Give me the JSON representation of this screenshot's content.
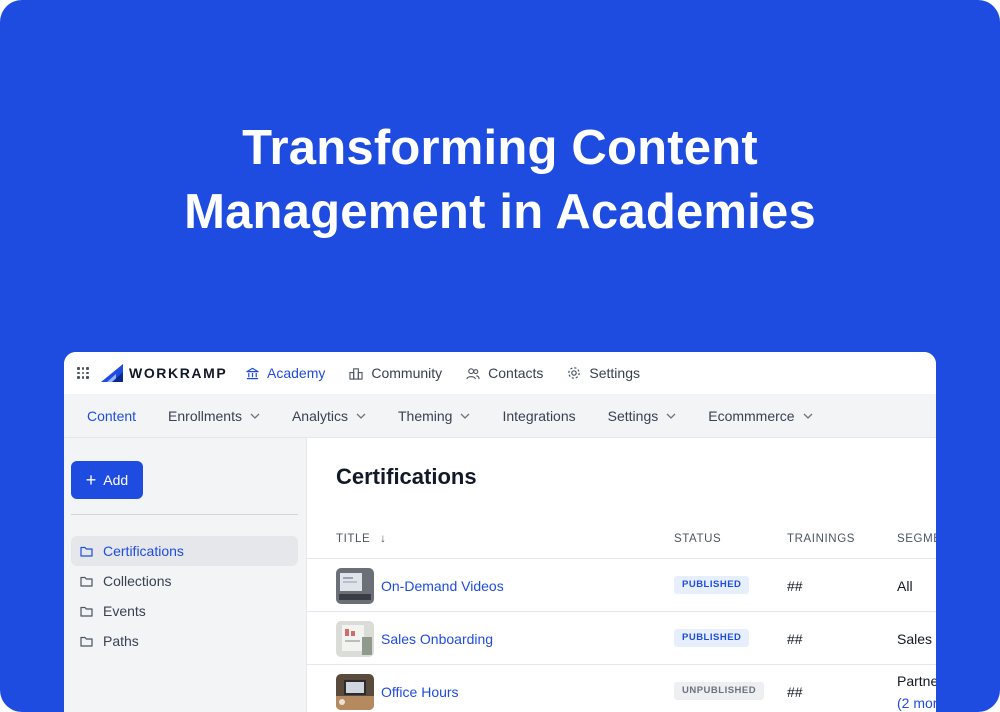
{
  "headline": {
    "line1": "Transforming Content",
    "line2": "Management in Academies"
  },
  "app": {
    "logo_text": "WORKRAMP",
    "top_nav": [
      {
        "label": "Academy",
        "icon": "bank-icon",
        "active": true
      },
      {
        "label": "Community",
        "icon": "community-icon",
        "active": false
      },
      {
        "label": "Contacts",
        "icon": "contacts-icon",
        "active": false
      },
      {
        "label": "Settings",
        "icon": "gear-icon",
        "active": false
      }
    ],
    "sub_nav": [
      {
        "label": "Content",
        "dropdown": false,
        "active": true
      },
      {
        "label": "Enrollments",
        "dropdown": true
      },
      {
        "label": "Analytics",
        "dropdown": true
      },
      {
        "label": "Theming",
        "dropdown": true
      },
      {
        "label": "Integrations",
        "dropdown": false
      },
      {
        "label": "Settings",
        "dropdown": true
      },
      {
        "label": "Ecommmerce",
        "dropdown": true
      }
    ],
    "sidebar": {
      "add_label": "Add",
      "items": [
        {
          "label": "Certifications",
          "active": true
        },
        {
          "label": "Collections"
        },
        {
          "label": "Events"
        },
        {
          "label": "Paths"
        }
      ]
    },
    "main": {
      "title": "Certifications",
      "columns": {
        "title": "TITLE",
        "sort_arrow": "↓",
        "status": "STATUS",
        "trainings": "TRAININGS",
        "segment": "SEGME"
      },
      "rows": [
        {
          "title": "On-Demand Videos",
          "status": "PUBLISHED",
          "trainings": "##",
          "segment": "All",
          "segment_more": ""
        },
        {
          "title": "Sales Onboarding",
          "status": "PUBLISHED",
          "trainings": "##",
          "segment": "Sales",
          "segment_more": ""
        },
        {
          "title": "Office Hours",
          "status": "UNPUBLISHED",
          "trainings": "##",
          "segment": "Partne",
          "segment_more": "(2 mor"
        }
      ]
    }
  },
  "colors": {
    "brand_blue": "#1f4ce0",
    "published_bg": "#e8effc",
    "unpublished_bg": "#eeeff1"
  }
}
